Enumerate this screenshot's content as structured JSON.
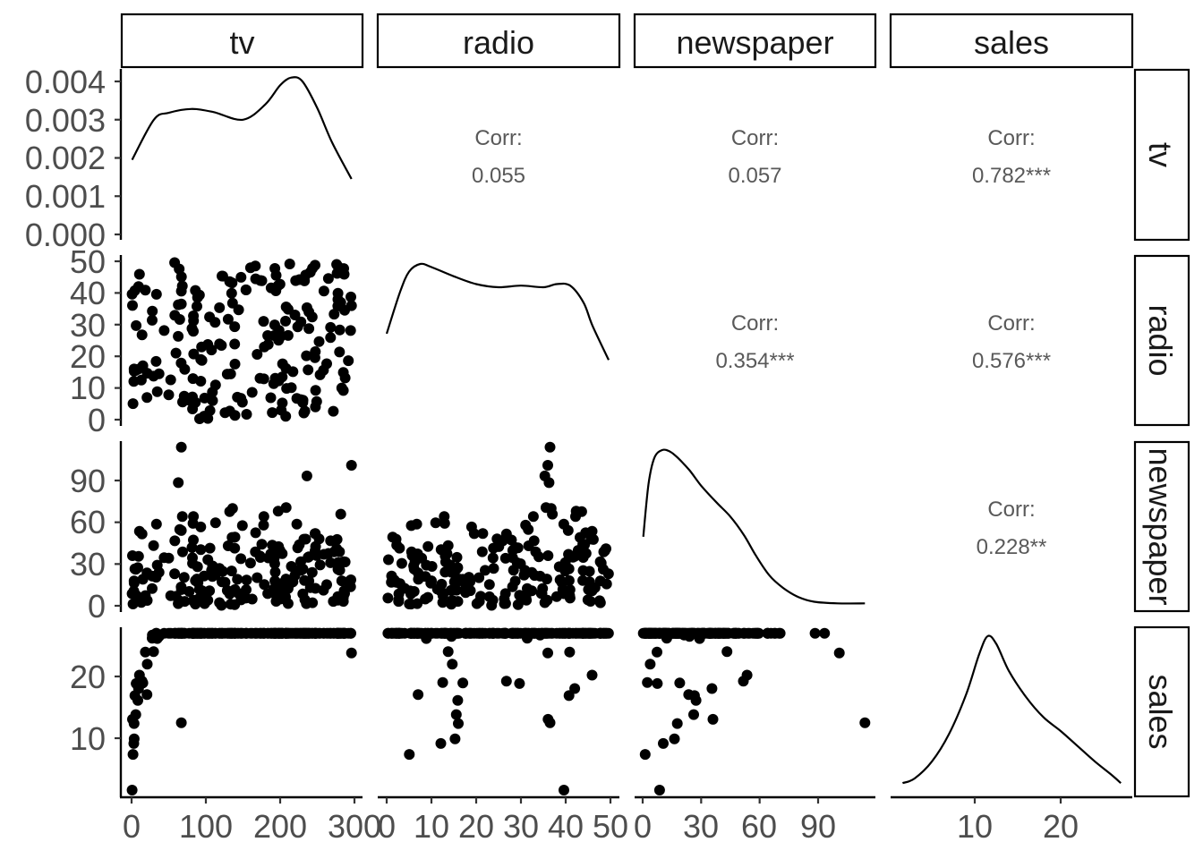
{
  "chart_data": {
    "type": "scatter",
    "title": "",
    "description": "Pairs plot (scatterplot matrix) of tv, radio, newspaper and sales",
    "variables": [
      "tv",
      "radio",
      "newspaper",
      "sales"
    ],
    "column_strips": [
      "tv",
      "radio",
      "newspaper",
      "sales"
    ],
    "row_strips": [
      "tv",
      "radio",
      "newspaper",
      "sales"
    ],
    "row_strip_visible_text": [
      "tv",
      "radio",
      "newspape",
      "sales"
    ],
    "grid": false,
    "axes": {
      "tv": {
        "range": [
          0,
          300
        ],
        "ticks": [
          0,
          100,
          200,
          300
        ],
        "tick_labels": [
          "0",
          "100",
          "200",
          "300"
        ]
      },
      "radio": {
        "range": [
          0,
          50
        ],
        "ticks": [
          0,
          10,
          20,
          30,
          40,
          50
        ],
        "tick_labels": [
          "0",
          "10",
          "20",
          "30",
          "40",
          "50"
        ]
      },
      "newspaper": {
        "range": [
          0,
          114
        ],
        "ticks": [
          0,
          30,
          60,
          90
        ],
        "tick_labels": [
          "0",
          "30",
          "60",
          "90"
        ]
      },
      "sales": {
        "range": [
          1.6,
          27
        ],
        "ticks": [
          10,
          20
        ],
        "tick_labels": [
          "10",
          "20"
        ]
      },
      "tv_density": {
        "range": [
          0,
          0.0041
        ],
        "ticks": [
          0,
          0.001,
          0.002,
          0.003,
          0.004
        ],
        "tick_labels": [
          "0.000",
          "0.001",
          "0.002",
          "0.003",
          "0.004"
        ]
      }
    },
    "correlations": [
      {
        "row": "tv",
        "col": "radio",
        "label": "Corr:",
        "value": "0.055"
      },
      {
        "row": "tv",
        "col": "newspaper",
        "label": "Corr:",
        "value": "0.057"
      },
      {
        "row": "tv",
        "col": "sales",
        "label": "Corr:",
        "value": "0.782***"
      },
      {
        "row": "radio",
        "col": "newspaper",
        "label": "Corr:",
        "value": "0.354***"
      },
      {
        "row": "radio",
        "col": "sales",
        "label": "Corr:",
        "value": "0.576***"
      },
      {
        "row": "newspaper",
        "col": "sales",
        "label": "Corr:",
        "value": "0.228**"
      }
    ],
    "densities": {
      "tv": {
        "x": [
          0.7,
          30,
          50,
          80,
          110,
          150,
          180,
          200,
          215,
          230,
          250,
          270,
          296
        ],
        "y": [
          0.00195,
          0.003,
          0.00318,
          0.00328,
          0.0032,
          0.003,
          0.0034,
          0.0039,
          0.0041,
          0.004,
          0.0033,
          0.0024,
          0.00145
        ]
      },
      "radio": {
        "x": [
          0,
          3,
          5,
          7.5,
          10,
          15,
          20,
          25,
          30,
          35,
          38,
          41,
          44,
          46,
          49.6
        ],
        "rel": [
          0.55,
          0.82,
          0.95,
          1.0,
          0.98,
          0.92,
          0.87,
          0.85,
          0.86,
          0.85,
          0.87,
          0.86,
          0.75,
          0.6,
          0.38
        ]
      },
      "newspaper": {
        "x": [
          0.3,
          3,
          6,
          10,
          14,
          18,
          24,
          30,
          38,
          45,
          52,
          58,
          65,
          72,
          80,
          88,
          100,
          114
        ],
        "rel": [
          0.44,
          0.78,
          0.95,
          1.0,
          0.99,
          0.95,
          0.87,
          0.77,
          0.66,
          0.57,
          0.45,
          0.32,
          0.19,
          0.11,
          0.05,
          0.02,
          0.01,
          0.01
        ]
      },
      "sales": {
        "x": [
          1.6,
          3,
          5,
          7,
          9,
          10.5,
          11.5,
          12.5,
          14,
          16,
          18,
          20,
          22,
          24,
          26,
          27
        ],
        "rel": [
          0.04,
          0.07,
          0.18,
          0.36,
          0.62,
          0.88,
          1.0,
          0.95,
          0.77,
          0.6,
          0.47,
          0.38,
          0.28,
          0.18,
          0.09,
          0.04
        ]
      }
    },
    "n_points": 200,
    "scatter_note": "Each scatter panel shows 200 observations; pairs are approximated from the visible point clouds."
  }
}
